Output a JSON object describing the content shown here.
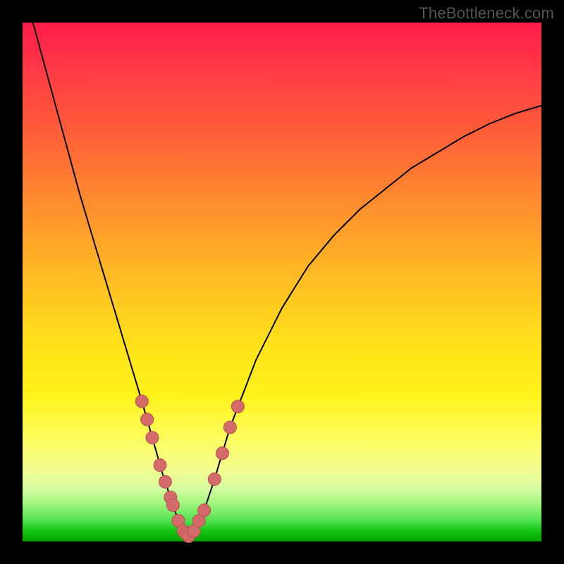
{
  "watermark": {
    "text": "TheBottleneck.com"
  },
  "colors": {
    "background": "#000000",
    "curve": "#000000",
    "marker_fill": "#d46a6a",
    "marker_stroke": "#b84f4f",
    "gradient_top": "#ff1b4a",
    "gradient_bottom": "#00a300"
  },
  "chart_data": {
    "type": "line",
    "title": "",
    "xlabel": "",
    "ylabel": "",
    "xlim": [
      0,
      100
    ],
    "ylim": [
      0,
      100
    ],
    "grid": false,
    "legend": false,
    "series": [
      {
        "name": "bottleneck-curve",
        "x": [
          2,
          5,
          8,
          11,
          14,
          17,
          20,
          23,
          25,
          27,
          29,
          30,
          31,
          32,
          33,
          35,
          37,
          40,
          45,
          50,
          55,
          60,
          65,
          70,
          75,
          80,
          85,
          90,
          95,
          100
        ],
        "y": [
          100,
          89,
          78,
          67,
          57,
          47,
          37,
          27,
          20,
          13,
          7,
          4,
          2,
          1,
          2,
          6,
          12,
          22,
          35,
          45,
          53,
          59,
          64,
          68,
          72,
          75,
          78,
          80.5,
          82.5,
          84
        ]
      }
    ],
    "markers": [
      {
        "series": "bottleneck-curve",
        "x": 23.0,
        "y": 27.0
      },
      {
        "series": "bottleneck-curve",
        "x": 24.0,
        "y": 23.5
      },
      {
        "series": "bottleneck-curve",
        "x": 25.0,
        "y": 20.0
      },
      {
        "series": "bottleneck-curve",
        "x": 26.5,
        "y": 14.7
      },
      {
        "series": "bottleneck-curve",
        "x": 27.5,
        "y": 11.5
      },
      {
        "series": "bottleneck-curve",
        "x": 28.5,
        "y": 8.5
      },
      {
        "series": "bottleneck-curve",
        "x": 29.0,
        "y": 7.0
      },
      {
        "series": "bottleneck-curve",
        "x": 30.0,
        "y": 4.0
      },
      {
        "series": "bottleneck-curve",
        "x": 31.0,
        "y": 2.0
      },
      {
        "series": "bottleneck-curve",
        "x": 31.5,
        "y": 1.5
      },
      {
        "series": "bottleneck-curve",
        "x": 32.0,
        "y": 1.0
      },
      {
        "series": "bottleneck-curve",
        "x": 33.0,
        "y": 2.0
      },
      {
        "series": "bottleneck-curve",
        "x": 34.0,
        "y": 4.0
      },
      {
        "series": "bottleneck-curve",
        "x": 35.0,
        "y": 6.0
      },
      {
        "series": "bottleneck-curve",
        "x": 37.0,
        "y": 12.0
      },
      {
        "series": "bottleneck-curve",
        "x": 38.5,
        "y": 17.0
      },
      {
        "series": "bottleneck-curve",
        "x": 40.0,
        "y": 22.0
      },
      {
        "series": "bottleneck-curve",
        "x": 41.5,
        "y": 26.0
      }
    ]
  }
}
